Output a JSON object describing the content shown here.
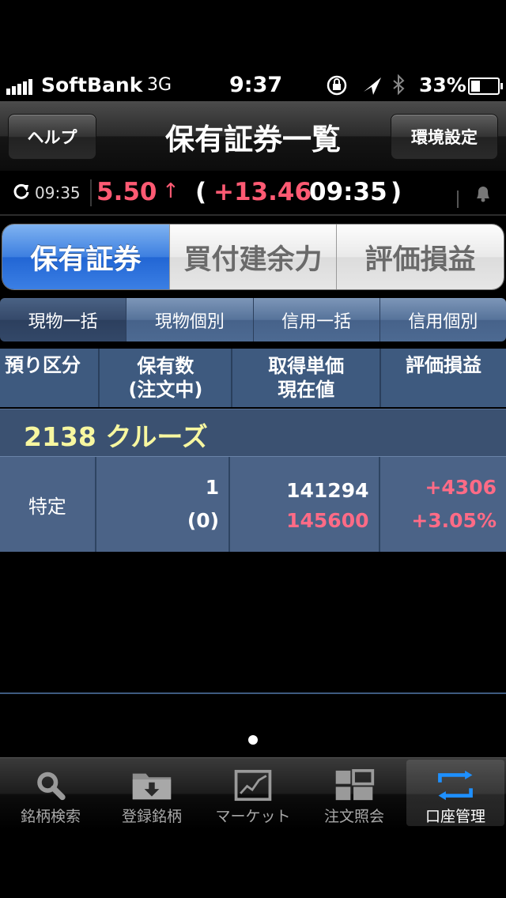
{
  "status_bar": {
    "carrier": "SoftBank",
    "network": "3G",
    "time": "9:37",
    "battery": "33%",
    "battery_level": 0.33
  },
  "nav": {
    "help_button": "ヘルプ",
    "title": "保有証券一覧",
    "settings_button": "環境設定"
  },
  "ticker": {
    "update_time": "09:35",
    "value": "5.50",
    "arrow": "↑",
    "open_paren": "(",
    "change": "+13.46",
    "time": "09:35",
    "close_paren": ")",
    "accent_color": "#ff5a73"
  },
  "main_tabs": [
    {
      "label": "保有証券",
      "active": true
    },
    {
      "label": "買付建余力",
      "active": false
    },
    {
      "label": "評価損益",
      "active": false
    }
  ],
  "sub_tabs": [
    {
      "label": "現物一括",
      "active": true
    },
    {
      "label": "現物個別",
      "active": false
    },
    {
      "label": "信用一括",
      "active": false
    },
    {
      "label": "信用個別",
      "active": false
    }
  ],
  "table": {
    "headers": {
      "kubun": "預り区分",
      "qty_line1": "保有数",
      "qty_line2": "(注文中)",
      "price_line1": "取得単価",
      "price_line2": "現在値",
      "pl": "評価損益"
    },
    "stock": {
      "name": "2138 クルーズ",
      "kubun": "特定",
      "quantity": "1",
      "ordering": "(0)",
      "acquisition_price": "141294",
      "current_price": "145600",
      "pl_amount": "+4306",
      "pl_percent": "+3.05%"
    }
  },
  "tab_bar": [
    {
      "label": "銘柄検索",
      "icon": "search-icon",
      "active": false
    },
    {
      "label": "登録銘柄",
      "icon": "folder-download-icon",
      "active": false
    },
    {
      "label": "マーケット",
      "icon": "chart-icon",
      "active": false
    },
    {
      "label": "注文照会",
      "icon": "grid-icon",
      "active": false
    },
    {
      "label": "口座管理",
      "icon": "refresh-loop-icon",
      "active": true
    }
  ]
}
